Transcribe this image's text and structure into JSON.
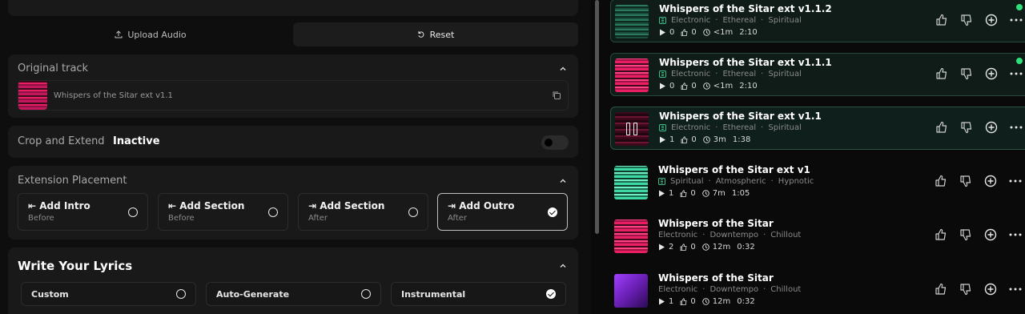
{
  "left": {
    "upload_label": "Upload Audio",
    "reset_label": "Reset",
    "original": {
      "title": "Original track",
      "track_name": "Whispers of the Sitar ext v1.1"
    },
    "crop": {
      "title": "Crop and Extend",
      "status": "Inactive"
    },
    "extension": {
      "title": "Extension Placement",
      "options": [
        {
          "label": "Add Intro",
          "sub": "Before",
          "selected": false
        },
        {
          "label": "Add Section",
          "sub": "Before",
          "selected": false
        },
        {
          "label": "Add Section",
          "sub": "After",
          "selected": false
        },
        {
          "label": "Add Outro",
          "sub": "After",
          "selected": true
        }
      ]
    },
    "lyrics": {
      "title": "Write Your Lyrics",
      "options": [
        {
          "label": "Custom",
          "selected": false
        },
        {
          "label": "Auto-Generate",
          "selected": false
        },
        {
          "label": "Instrumental",
          "selected": true
        }
      ]
    }
  },
  "tracks": [
    {
      "title": "Whispers of the Sitar ext v1.1.2",
      "tags": [
        "Electronic",
        "Ethereal",
        "Spiritual"
      ],
      "plays": "0",
      "likes": "0",
      "age": "<1m",
      "duration": "2:10",
      "cover": "teal"
    },
    {
      "title": "Whispers of the Sitar ext v1.1.1",
      "tags": [
        "Electronic",
        "Ethereal",
        "Spiritual"
      ],
      "plays": "0",
      "likes": "0",
      "age": "<1m",
      "duration": "2:10",
      "cover": "pink"
    },
    {
      "title": "Whispers of the Sitar ext v1.1",
      "tags": [
        "Electronic",
        "Ethereal",
        "Spiritual"
      ],
      "plays": "1",
      "likes": "0",
      "age": "3m",
      "duration": "1:38",
      "cover": "dark"
    },
    {
      "title": "Whispers of the Sitar ext v1",
      "tags": [
        "Spiritual",
        "Atmospheric",
        "Hypnotic"
      ],
      "plays": "1",
      "likes": "0",
      "age": "7m",
      "duration": "1:05",
      "cover": "green"
    },
    {
      "title": "Whispers of the Sitar",
      "tags": [
        "Electronic",
        "Downtempo",
        "Chillout"
      ],
      "plays": "2",
      "likes": "0",
      "age": "12m",
      "duration": "0:32",
      "cover": "pink"
    },
    {
      "title": "Whispers of the Sitar",
      "tags": [
        "Electronic",
        "Downtempo",
        "Chillout"
      ],
      "plays": "1",
      "likes": "0",
      "age": "12m",
      "duration": "0:32",
      "cover": "purple"
    }
  ],
  "colors": {
    "accent_green": "#2ee07a",
    "tag_green": "#3fbf8c"
  }
}
